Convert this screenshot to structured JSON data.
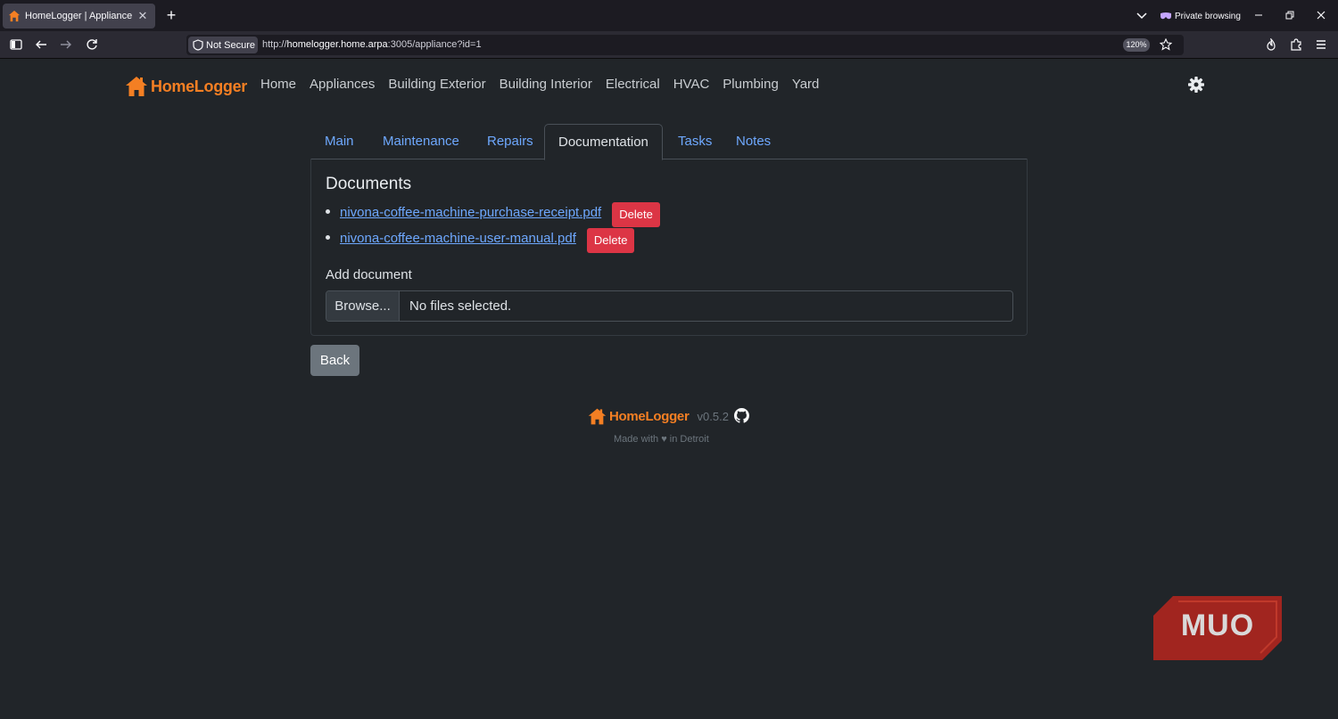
{
  "browser": {
    "tab_title": "HomeLogger | Appliance",
    "tab_close": "✕",
    "new_tab": "+",
    "private_label": "Private browsing",
    "security_label": "Not Secure",
    "url_prefix": "http://",
    "url_host": "homelogger.home.arpa",
    "url_rest": ":3005/appliance?id=1",
    "zoom": "120%"
  },
  "site": {
    "brand": "HomeLogger",
    "nav": [
      "Home",
      "Appliances",
      "Building Exterior",
      "Building Interior",
      "Electrical",
      "HVAC",
      "Plumbing",
      "Yard"
    ]
  },
  "tabs": {
    "main": "Main",
    "maintenance": "Maintenance",
    "repairs": "Repairs",
    "documentation": "Documentation",
    "tasks": "Tasks",
    "notes": "Notes"
  },
  "documents": {
    "heading": "Documents",
    "items": [
      {
        "name": "nivona-coffee-machine-purchase-receipt.pdf",
        "delete_label": "Delete"
      },
      {
        "name": "nivona-coffee-machine-user-manual.pdf",
        "delete_label": "Delete"
      }
    ],
    "add_label": "Add document",
    "browse_label": "Browse...",
    "file_status": "No files selected."
  },
  "back_label": "Back",
  "footer": {
    "brand": "HomeLogger",
    "version": "v0.5.2",
    "made_with": "Made with ♥ in Detroit"
  },
  "watermark": "MUO",
  "colors": {
    "brand": "#f47f23",
    "link": "#6ea8fe",
    "danger": "#dc3545",
    "secondary": "#6c757d",
    "background": "#212529"
  }
}
